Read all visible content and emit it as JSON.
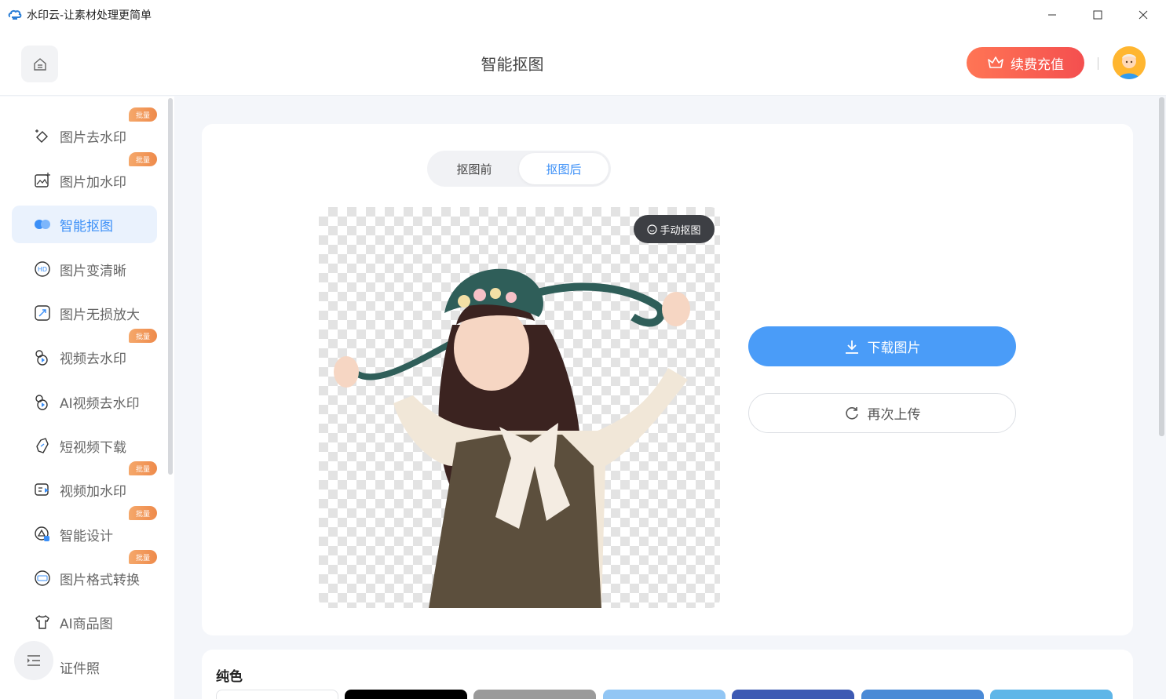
{
  "window": {
    "title": "水印云-让素材处理更简单",
    "controls": [
      "minimize",
      "maximize",
      "close"
    ]
  },
  "header": {
    "page_title": "智能抠图",
    "renew_label": "续费充值",
    "brand_color": "#f4604f"
  },
  "sidebar": {
    "items": [
      {
        "label": "图片去水印",
        "icon": "eraser-icon",
        "badge": "批量",
        "active": false
      },
      {
        "label": "图片加水印",
        "icon": "image-add-icon",
        "badge": "批量",
        "active": false
      },
      {
        "label": "智能抠图",
        "icon": "cutout-icon",
        "badge": "",
        "active": true
      },
      {
        "label": "图片变清晰",
        "icon": "hd-icon",
        "badge": "",
        "active": false
      },
      {
        "label": "图片无损放大",
        "icon": "enlarge-icon",
        "badge": "",
        "active": false
      },
      {
        "label": "视频去水印",
        "icon": "video-eraser-icon",
        "badge": "批量",
        "active": false
      },
      {
        "label": "AI视频去水印",
        "icon": "ai-video-icon",
        "badge": "",
        "active": false
      },
      {
        "label": "短视频下载",
        "icon": "link-icon",
        "badge": "",
        "active": false
      },
      {
        "label": "视频加水印",
        "icon": "video-add-icon",
        "badge": "批量",
        "active": false
      },
      {
        "label": "智能设计",
        "icon": "design-icon",
        "badge": "批量",
        "active": false
      },
      {
        "label": "图片格式转换",
        "icon": "jpg-icon",
        "badge": "批量",
        "active": false
      },
      {
        "label": "AI商品图",
        "icon": "shirt-icon",
        "badge": "",
        "active": false
      },
      {
        "label": "证件照",
        "icon": "id-photo-icon",
        "badge": "",
        "active": false
      }
    ]
  },
  "main": {
    "tabs": [
      {
        "label": "抠图前",
        "active": false
      },
      {
        "label": "抠图后",
        "active": true
      }
    ],
    "manual_cutout_label": "手动抠图",
    "download_label": "下载图片",
    "reupload_label": "再次上传",
    "accent_color": "#4a9cf8"
  },
  "background_panel": {
    "section_title": "纯色",
    "swatches": [
      "#ffffff",
      "#000000",
      "#9a9a9a",
      "#92c6f4",
      "#3d5ab3",
      "#4a8ad6",
      "#5fb6e8"
    ]
  }
}
